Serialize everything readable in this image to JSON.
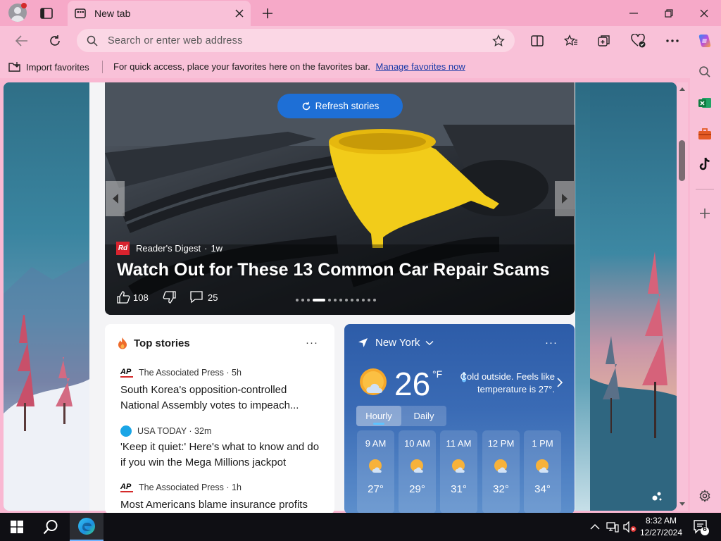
{
  "browser": {
    "tab": {
      "title": "New tab"
    },
    "address_bar": {
      "placeholder": "Search or enter web address"
    },
    "favorites_bar": {
      "import_label": "Import favorites",
      "message": "For quick access, place your favorites here on the favorites bar.",
      "link": "Manage favorites now"
    }
  },
  "feed": {
    "refresh_label": "Refresh stories",
    "hero": {
      "source": "Reader's Digest",
      "source_logo": "Rd",
      "age": "1w",
      "title": "Watch Out for These 13 Common Car Repair Scams",
      "likes": "108",
      "comments": "25",
      "carousel_count": 13,
      "carousel_active": 3
    },
    "top_stories": {
      "header": "Top stories",
      "items": [
        {
          "logo": "AP",
          "source": "The Associated Press · 5h",
          "title": "South Korea's opposition-controlled National Assembly votes to impeach..."
        },
        {
          "logo": "usa-today",
          "source": "USA TODAY · 32m",
          "title": "'Keep it quiet:' Here's what to know and do if you win the Mega Millions jackpot"
        },
        {
          "logo": "AP",
          "source": "The Associated Press · 1h",
          "title": "Most Americans blame insurance profits"
        }
      ]
    },
    "weather": {
      "location": "New York",
      "temp": "26",
      "unit": "°F",
      "note": "Cold outside. Feels like temperature is 27°.",
      "tabs": [
        "Hourly",
        "Daily"
      ],
      "selected_tab": "Hourly",
      "hours": [
        {
          "time": "9 AM",
          "temp": "27°"
        },
        {
          "time": "10 AM",
          "temp": "29°"
        },
        {
          "time": "11 AM",
          "temp": "31°"
        },
        {
          "time": "12 PM",
          "temp": "32°"
        },
        {
          "time": "1 PM",
          "temp": "34°"
        }
      ]
    }
  },
  "taskbar": {
    "time": "8:32 AM",
    "date": "12/27/2024",
    "notification_count": "6"
  },
  "colors": {
    "titlebar": "#f6a9c8",
    "toolbar": "#f9c1d8",
    "accent": "#1e6fd6",
    "taskbar": "#0f0f14"
  }
}
